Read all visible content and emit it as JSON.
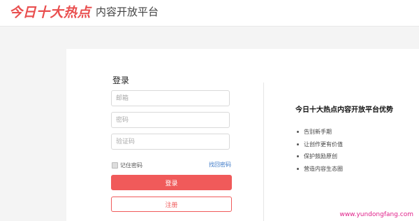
{
  "header": {
    "logo_text": "今日十大热点",
    "platform_title": "内容开放平台"
  },
  "login": {
    "title": "登录",
    "email_placeholder": "邮箱",
    "password_placeholder": "密码",
    "captcha_placeholder": "验证码",
    "remember_label": "记住密码",
    "forgot_label": "找回密码",
    "login_button": "登录",
    "register_button": "注册"
  },
  "advantages": {
    "title": "今日十大热点内容开放平台优势",
    "items": [
      "告别新手期",
      "让创作更有价值",
      "保护鼓励原创",
      "营造内容生态圈"
    ]
  },
  "watermark": "www.yundongfang.com",
  "colors": {
    "brand_red": "#e94f4f",
    "button_red": "#f05a5a",
    "link_blue": "#3b78c7",
    "watermark_pink": "#e0218a"
  }
}
